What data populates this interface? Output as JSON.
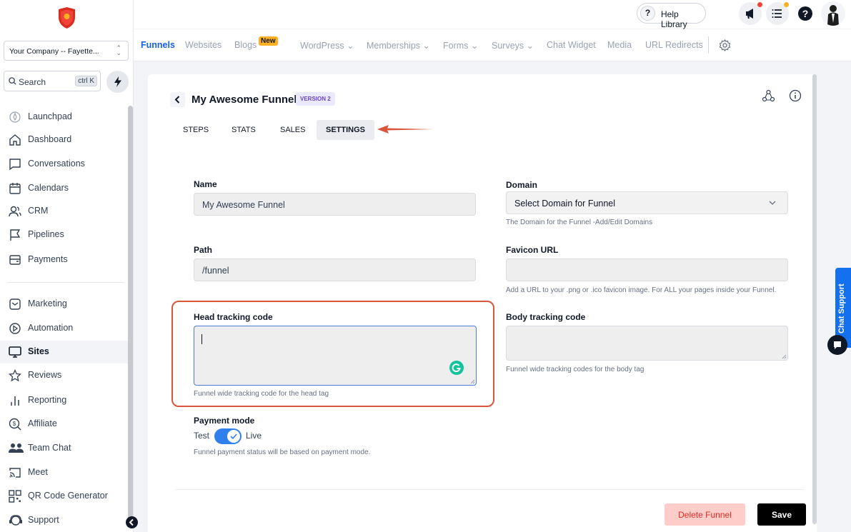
{
  "sidebar": {
    "company": "Your Company -- Fayette...",
    "search_label": "Search",
    "search_shortcut": "ctrl K",
    "items": [
      {
        "label": "Launchpad",
        "icon": "rocket-icon"
      },
      {
        "label": "Dashboard",
        "icon": "home-icon"
      },
      {
        "label": "Conversations",
        "icon": "chat-icon"
      },
      {
        "label": "Calendars",
        "icon": "calendar-icon"
      },
      {
        "label": "CRM",
        "icon": "users-icon"
      },
      {
        "label": "Pipelines",
        "icon": "flag-icon"
      },
      {
        "label": "Payments",
        "icon": "wallet-icon"
      },
      {
        "label": "Marketing",
        "icon": "envelope-icon"
      },
      {
        "label": "Automation",
        "icon": "play-icon"
      },
      {
        "label": "Sites",
        "icon": "monitor-icon"
      },
      {
        "label": "Reviews",
        "icon": "star-icon"
      },
      {
        "label": "Reporting",
        "icon": "bar-chart-icon"
      },
      {
        "label": "Affiliate",
        "icon": "dollar-icon"
      },
      {
        "label": "Team Chat",
        "icon": "team-icon"
      },
      {
        "label": "Meet",
        "icon": "cast-icon"
      },
      {
        "label": "QR Code Generator",
        "icon": "qr-icon"
      },
      {
        "label": "Support",
        "icon": "support-icon"
      }
    ],
    "active_item": "Sites"
  },
  "topbar": {
    "help_label": "Help Library"
  },
  "subnav": {
    "tabs": [
      "Funnels",
      "Websites",
      "Blogs",
      "WordPress",
      "Memberships",
      "Forms",
      "Surveys",
      "Chat Widget",
      "Media",
      "URL Redirects"
    ],
    "new_badge": "New",
    "active": "Funnels"
  },
  "funnel": {
    "title": "My Awesome Funnel",
    "version": "VERSION 2",
    "tabs": [
      "STEPS",
      "STATS",
      "SALES",
      "SETTINGS"
    ],
    "active_tab": "SETTINGS"
  },
  "settings": {
    "name_label": "Name",
    "name_value": "My Awesome Funnel",
    "domain_label": "Domain",
    "domain_value": "Select Domain for Funnel",
    "domain_hint": "The Domain for the Funnel -Add/Edit Domains",
    "path_label": "Path",
    "path_value": "/funnel",
    "favicon_label": "Favicon URL",
    "favicon_value": "",
    "favicon_hint": "Add a URL to your .png or .ico favicon image. For ALL your pages inside your Funnel.",
    "head_label": "Head tracking code",
    "head_value": "",
    "head_hint": "Funnel wide tracking code for the head tag",
    "body_label": "Body tracking code",
    "body_value": "",
    "body_hint": "Funnel wide tracking codes for the body tag",
    "payment_label": "Payment mode",
    "payment_test": "Test",
    "payment_live": "Live",
    "payment_hint": "Funnel payment status will be based on payment mode.",
    "payment_live_enabled": true,
    "delete_label": "Delete Funnel",
    "save_label": "Save"
  },
  "chat_support": "Chat Support",
  "colors": {
    "accent": "#155eef",
    "annotation": "#d9553b",
    "toggle": "#2f80ed"
  }
}
